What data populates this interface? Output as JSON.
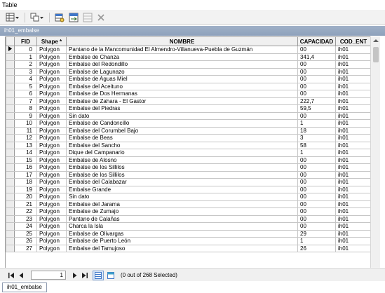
{
  "window": {
    "title": "Table"
  },
  "toolbar": {
    "buttons": [
      {
        "icon": "table-options-icon"
      },
      {
        "icon": "related-tables-icon"
      },
      {
        "icon": "select-by-attributes-icon"
      },
      {
        "icon": "switch-selection-icon"
      },
      {
        "icon": "clear-selection-icon"
      },
      {
        "icon": "delete-selected-icon"
      }
    ]
  },
  "tab": {
    "name": "ih01_embalse"
  },
  "table": {
    "columns": [
      "FID",
      "Shape *",
      "NOMBRE",
      "CAPACIDAD",
      "COD_ENT"
    ],
    "rows": [
      [
        "0",
        "Polygon",
        "Pantano de la Mancomunidad El Almendro-Villanueva-Puebla de Guzmán",
        "00",
        "ih01"
      ],
      [
        "1",
        "Polygon",
        "Embalse de Chanza",
        "341,4",
        "ih01"
      ],
      [
        "2",
        "Polygon",
        "Embalse del Redondillo",
        "00",
        "ih01"
      ],
      [
        "3",
        "Polygon",
        "Embalse de Lagunazo",
        "00",
        "ih01"
      ],
      [
        "4",
        "Polygon",
        "Embalse de Aguas Miel",
        "00",
        "ih01"
      ],
      [
        "5",
        "Polygon",
        "Embalse del Aceituno",
        "00",
        "ih01"
      ],
      [
        "6",
        "Polygon",
        "Embalse de Dos Hermanas",
        "00",
        "ih01"
      ],
      [
        "7",
        "Polygon",
        "Embalse de Zahara - El Gastor",
        "222,7",
        "ih01"
      ],
      [
        "8",
        "Polygon",
        "Embalse del Piedras",
        "59,5",
        "ih01"
      ],
      [
        "9",
        "Polygon",
        "Sin dato",
        "00",
        "ih01"
      ],
      [
        "10",
        "Polygon",
        "Embalse de Candoncillo",
        "1",
        "ih01"
      ],
      [
        "11",
        "Polygon",
        "Embalse del Corumbel Bajo",
        "18",
        "ih01"
      ],
      [
        "12",
        "Polygon",
        "Embalse de Beas",
        "3",
        "ih01"
      ],
      [
        "13",
        "Polygon",
        "Embalse del Sancho",
        "58",
        "ih01"
      ],
      [
        "14",
        "Polygon",
        "Dique del Campanario",
        "1",
        "ih01"
      ],
      [
        "15",
        "Polygon",
        "Embalse de Alosno",
        "00",
        "ih01"
      ],
      [
        "16",
        "Polygon",
        "Embalse de los Sillilos",
        "00",
        "ih01"
      ],
      [
        "17",
        "Polygon",
        "Embalse de los Sillilos",
        "00",
        "ih01"
      ],
      [
        "18",
        "Polygon",
        "Embalse del Calabazar",
        "00",
        "ih01"
      ],
      [
        "19",
        "Polygon",
        "Embalse Grande",
        "00",
        "ih01"
      ],
      [
        "20",
        "Polygon",
        "Sin dato",
        "00",
        "ih01"
      ],
      [
        "21",
        "Polygon",
        "Embalse del Jarama",
        "00",
        "ih01"
      ],
      [
        "22",
        "Polygon",
        "Embalse de Zumajo",
        "00",
        "ih01"
      ],
      [
        "23",
        "Polygon",
        "Pantano de Calañas",
        "00",
        "ih01"
      ],
      [
        "24",
        "Polygon",
        "Charca la Isla",
        "00",
        "ih01"
      ],
      [
        "25",
        "Polygon",
        "Embalse de Olivargas",
        "29",
        "ih01"
      ],
      [
        "26",
        "Polygon",
        "Embalse de Puerto León",
        "1",
        "ih01"
      ],
      [
        "27",
        "Polygon",
        "Embalse del Tamujoso",
        "26",
        "ih01"
      ]
    ]
  },
  "navigation": {
    "record": "1",
    "status": "(0 out of 268 Selected)"
  }
}
